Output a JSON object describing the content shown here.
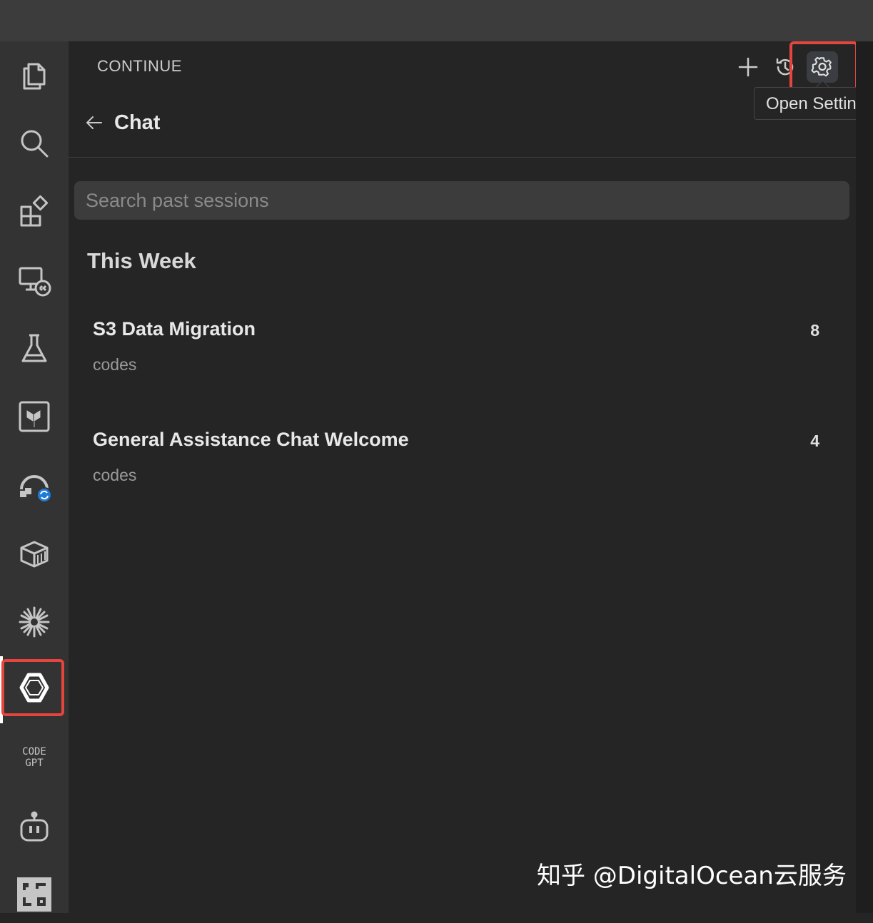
{
  "activity_bar": {
    "items": [
      {
        "icon": "files-icon"
      },
      {
        "icon": "search-icon"
      },
      {
        "icon": "extensions-icon"
      },
      {
        "icon": "remote-explorer-icon"
      },
      {
        "icon": "testing-flask-icon"
      },
      {
        "icon": "terraform-icon"
      },
      {
        "icon": "sync-extension-icon"
      },
      {
        "icon": "container-box-icon"
      },
      {
        "icon": "sparkle-burst-icon"
      },
      {
        "icon": "continue-logo-icon"
      },
      {
        "icon": "codegpt-icon",
        "text_line1": "CODE",
        "text_line2": "GPT"
      },
      {
        "icon": "robot-icon"
      },
      {
        "icon": "grid-logo-icon"
      }
    ],
    "active_index": 9
  },
  "panel": {
    "title": "CONTINUE",
    "tooltip": "Open Settings",
    "back_title": "Chat",
    "search_placeholder": "Search past sessions",
    "section_heading": "This Week",
    "sessions": [
      {
        "title": "S3 Data Migration",
        "subtitle": "codes",
        "count": "8"
      },
      {
        "title": "General Assistance Chat Welcome",
        "subtitle": "codes",
        "count": "4"
      }
    ]
  },
  "watermark": "知乎 @DigitalOcean云服务",
  "colors": {
    "highlight": "#e5453c",
    "panel_bg": "#252526",
    "activity_bg": "#333333",
    "titlebar_bg": "#3c3c3c",
    "badge": "#1f7ad8"
  }
}
